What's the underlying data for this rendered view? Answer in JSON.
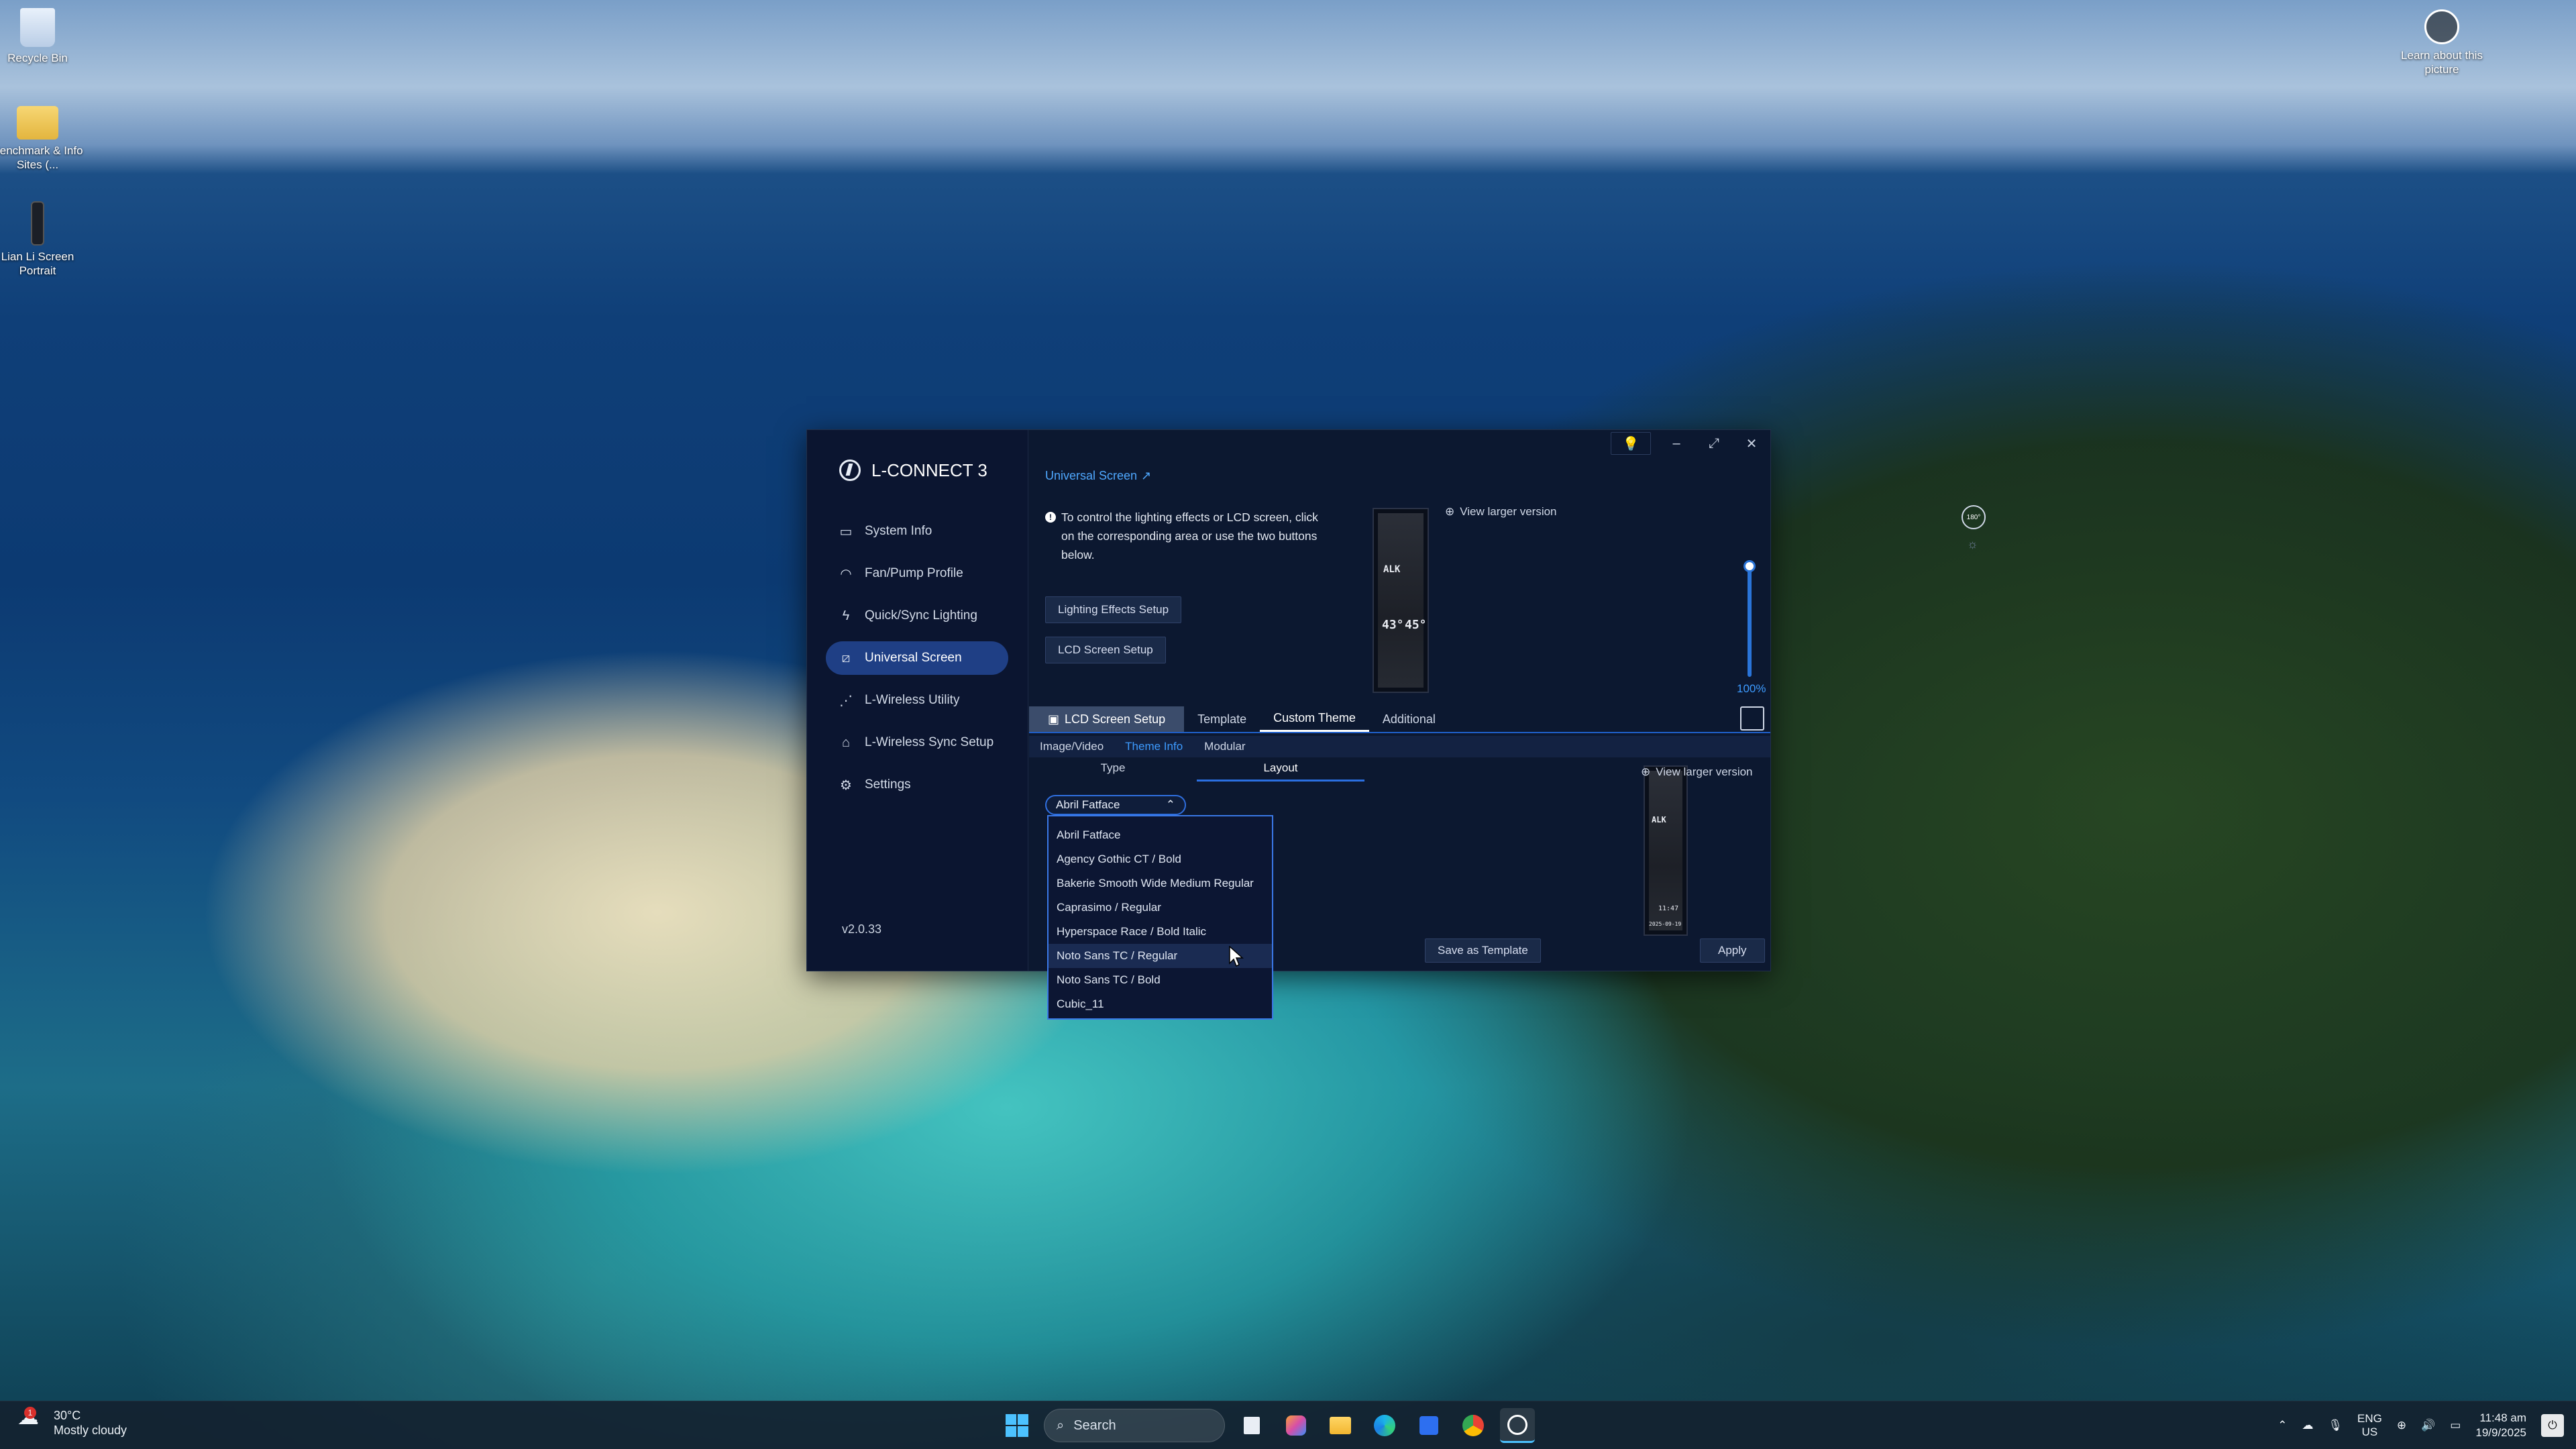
{
  "desktop": {
    "icons": [
      {
        "label": "Recycle Bin"
      },
      {
        "label": "Benchmark & Info Sites (..."
      },
      {
        "label": "Lian Li Screen Portrait"
      }
    ],
    "learn_label": "Learn about this picture"
  },
  "app": {
    "title": "L-CONNECT 3",
    "version": "v2.0.33",
    "nav": [
      {
        "label": "System Info",
        "icon": "monitor-icon"
      },
      {
        "label": "Fan/Pump Profile",
        "icon": "fan-icon"
      },
      {
        "label": "Quick/Sync Lighting",
        "icon": "bolt-icon"
      },
      {
        "label": "Universal Screen",
        "icon": "screen-icon",
        "active": true
      },
      {
        "label": "L-Wireless Utility",
        "icon": "wireless-icon"
      },
      {
        "label": "L-Wireless Sync Setup",
        "icon": "sync-icon"
      },
      {
        "label": "Settings",
        "icon": "gear-icon"
      }
    ],
    "breadcrumb": "Universal Screen",
    "info_text": "To control the lighting effects or LCD screen, click on the corresponding area or use the two buttons below.",
    "buttons": {
      "lighting_setup": "Lighting Effects Setup",
      "lcd_setup": "LCD Screen Setup",
      "save_template": "Save as Template",
      "apply": "Apply"
    },
    "view_larger": "View larger version",
    "rotate_badge": "180°",
    "brightness": "100%",
    "preview": {
      "brand": "ALK",
      "cpu": "43°",
      "gpu": "45°",
      "date": "2025-09-19",
      "time": "11:47"
    },
    "tabs_main": [
      {
        "label": "LCD Screen Setup"
      },
      {
        "label": "Template"
      },
      {
        "label": "Custom Theme"
      },
      {
        "label": "Additional"
      }
    ],
    "tabs_sub": [
      {
        "label": "Image/Video"
      },
      {
        "label": "Theme Info"
      },
      {
        "label": "Modular"
      }
    ],
    "subtabs": [
      {
        "label": "Type"
      },
      {
        "label": "Layout"
      }
    ],
    "font_select": {
      "value": "Abril Fatface"
    },
    "font_options": [
      "Abril Fatface",
      "Agency Gothic CT / Bold",
      "Bakerie Smooth Wide Medium Regular",
      "Caprasimo / Regular",
      "Hyperspace Race / Bold Italic",
      "Noto Sans TC / Regular",
      "Noto Sans TC / Bold",
      "Cubic_11"
    ]
  },
  "taskbar": {
    "weather_temp": "30°C",
    "weather_desc": "Mostly cloudy",
    "weather_badge": "1",
    "search_placeholder": "Search",
    "lang_top": "ENG",
    "lang_bottom": "US",
    "time": "11:48 am",
    "date": "19/9/2025"
  },
  "colors": {
    "accent": "#2b6fe0",
    "link": "#4fa8ff",
    "window_bg": "#0c1830"
  }
}
